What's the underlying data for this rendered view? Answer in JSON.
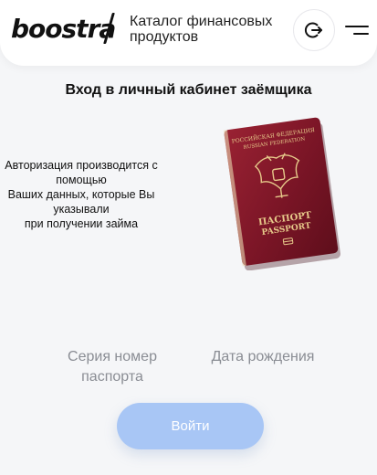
{
  "header": {
    "logo_text": "boostra",
    "catalog_link": "Каталог финансовых продуктов",
    "logout_icon": "logout-icon",
    "menu_icon": "hamburger-menu-icon"
  },
  "main": {
    "title": "Вход в личный кабинет заёмщика",
    "auth_note_lines": [
      "Авторизация производится с",
      "помощью",
      "Ваших данных, которые Вы",
      "указывали",
      "при получении займа"
    ],
    "passport_image": {
      "country_ru": "РОССИЙСКАЯ ФЕДЕРАЦИЯ",
      "country_en": "RUSSIAN FEDERATION",
      "label_ru": "ПАСПОРТ",
      "label_en": "PASSPORT"
    },
    "fields": {
      "series_line1": "Серия номер",
      "series_line2": "паспорта",
      "birth": "Дата рождения"
    },
    "login_button": "Войти"
  },
  "colors": {
    "background": "#f5f6f8",
    "button": "#a8c6f5",
    "passport": "#7d1626"
  }
}
